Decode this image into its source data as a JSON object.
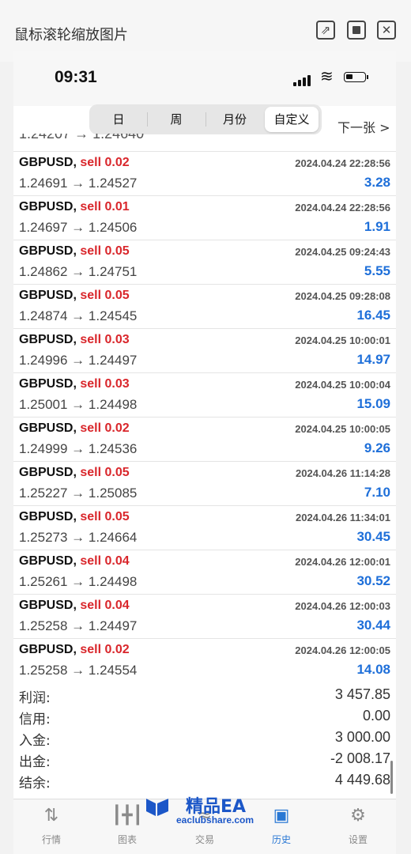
{
  "viewer": {
    "title": "鼠标滚轮缩放图片",
    "btn_open": "⇗",
    "btn_close": "✕"
  },
  "status": {
    "time": "09:31",
    "wifi": "wifi-icon",
    "battery_level": 0.25
  },
  "period_tabs": [
    "日",
    "周",
    "月份",
    "自定义"
  ],
  "active_tab": "自定义",
  "next_label": "下一张 >",
  "partial_row_text": "1.24207 → 1.24640",
  "deals": [
    {
      "symbol": "GBPUSD,",
      "side": "sell 0.02",
      "date": "2024.04.24 22:28:56",
      "prices": "1.24691 → 1.24527",
      "profit": "3.28"
    },
    {
      "symbol": "GBPUSD,",
      "side": "sell 0.01",
      "date": "2024.04.24 22:28:56",
      "prices": "1.24697 → 1.24506",
      "profit": "1.91"
    },
    {
      "symbol": "GBPUSD,",
      "side": "sell 0.05",
      "date": "2024.04.25 09:24:43",
      "prices": "1.24862 → 1.24751",
      "profit": "5.55"
    },
    {
      "symbol": "GBPUSD,",
      "side": "sell 0.05",
      "date": "2024.04.25 09:28:08",
      "prices": "1.24874 → 1.24545",
      "profit": "16.45"
    },
    {
      "symbol": "GBPUSD,",
      "side": "sell 0.03",
      "date": "2024.04.25 10:00:01",
      "prices": "1.24996 → 1.24497",
      "profit": "14.97"
    },
    {
      "symbol": "GBPUSD,",
      "side": "sell 0.03",
      "date": "2024.04.25 10:00:04",
      "prices": "1.25001 → 1.24498",
      "profit": "15.09"
    },
    {
      "symbol": "GBPUSD,",
      "side": "sell 0.02",
      "date": "2024.04.25 10:00:05",
      "prices": "1.24999 → 1.24536",
      "profit": "9.26"
    },
    {
      "symbol": "GBPUSD,",
      "side": "sell 0.05",
      "date": "2024.04.26 11:14:28",
      "prices": "1.25227 → 1.25085",
      "profit": "7.10"
    },
    {
      "symbol": "GBPUSD,",
      "side": "sell 0.05",
      "date": "2024.04.26 11:34:01",
      "prices": "1.25273 → 1.24664",
      "profit": "30.45"
    },
    {
      "symbol": "GBPUSD,",
      "side": "sell 0.04",
      "date": "2024.04.26 12:00:01",
      "prices": "1.25261 → 1.24498",
      "profit": "30.52"
    },
    {
      "symbol": "GBPUSD,",
      "side": "sell 0.04",
      "date": "2024.04.26 12:00:03",
      "prices": "1.25258 → 1.24497",
      "profit": "30.44"
    },
    {
      "symbol": "GBPUSD,",
      "side": "sell 0.02",
      "date": "2024.04.26 12:00:05",
      "prices": "1.25258 → 1.24554",
      "profit": "14.08"
    }
  ],
  "summary": [
    {
      "label": "利润:",
      "value": "3 457.85"
    },
    {
      "label": "信用:",
      "value": "0.00"
    },
    {
      "label": "入金:",
      "value": "3 000.00"
    },
    {
      "label": "出金:",
      "value": "-2 008.17"
    },
    {
      "label": "结余:",
      "value": "4 449.68"
    }
  ],
  "tabs": [
    {
      "label": "行情",
      "icon": "quotes-icon"
    },
    {
      "label": "图表",
      "icon": "chart-icon"
    },
    {
      "label": "交易",
      "icon": "trade-icon"
    },
    {
      "label": "历史",
      "icon": "history-icon"
    },
    {
      "label": "设置",
      "icon": "settings-icon"
    }
  ],
  "active_bottom_tab": "历史",
  "watermark": {
    "title": "精品EA",
    "site": "eaclubshare.com"
  },
  "colors": {
    "sell": "#d9262b",
    "profit": "#1e6fd9",
    "active_tab": "#2a78d4",
    "watermark": "#1c57c8"
  }
}
